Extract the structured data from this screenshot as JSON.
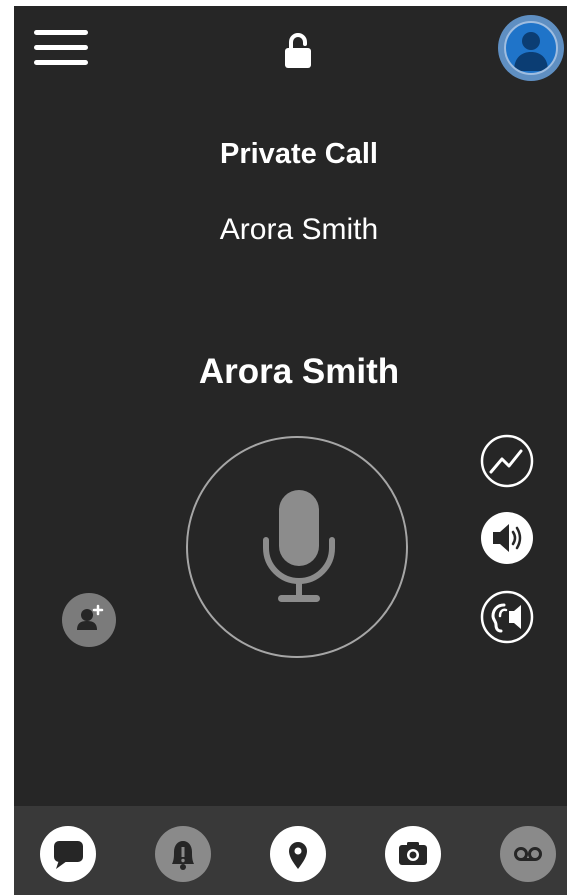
{
  "header": {
    "menu_icon": "hamburger-menu-icon",
    "lock_icon": "unlocked-padlock-icon",
    "avatar_icon": "user-avatar-icon"
  },
  "call": {
    "type_label": "Private Call",
    "target_name": "Arora Smith",
    "speaker_name": "Arora Smith",
    "ptt_icon": "microphone-icon"
  },
  "side_controls": {
    "items": [
      {
        "icon": "trend-line-icon"
      },
      {
        "icon": "speaker-volume-icon"
      },
      {
        "icon": "earpiece-icon"
      }
    ],
    "add_member_icon": "add-user-icon"
  },
  "bottom_nav": {
    "items": [
      {
        "icon": "chat-bubble-icon"
      },
      {
        "icon": "alert-bell-icon"
      },
      {
        "icon": "location-pin-icon"
      },
      {
        "icon": "camera-icon"
      },
      {
        "icon": "voicemail-icon"
      }
    ]
  },
  "colors": {
    "background": "#262626",
    "bottom_bar": "#393939",
    "avatar_blue": "#1f74c9",
    "muted_gray": "#7b7b7b"
  }
}
